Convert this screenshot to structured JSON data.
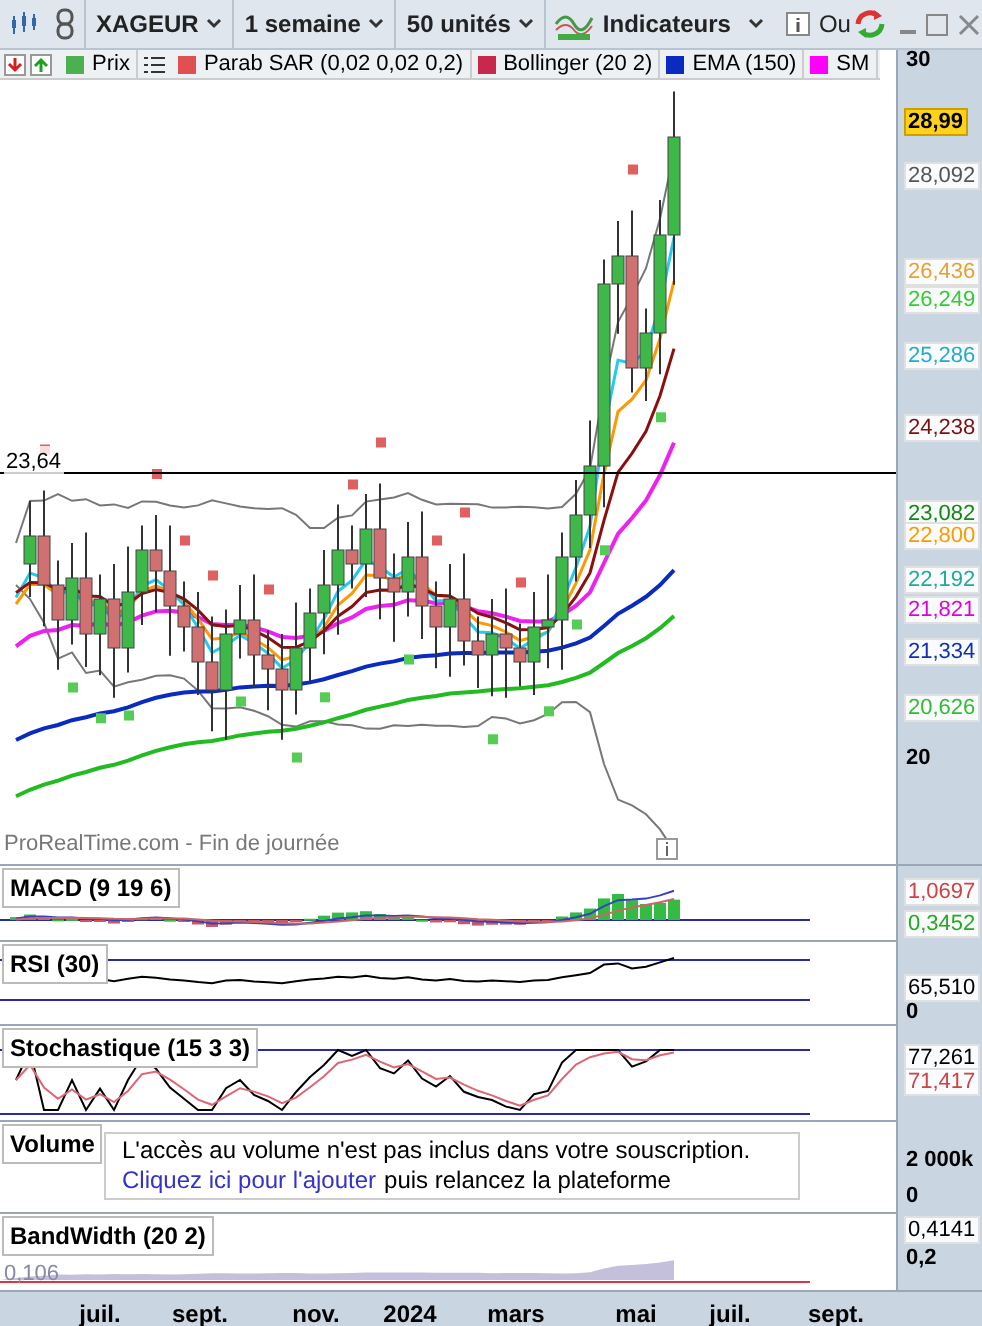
{
  "toolbar": {
    "symbol": "XAGEUR",
    "period": "1 semaine",
    "units": "50 unités",
    "indicators": "Indicateurs",
    "more": "Ou"
  },
  "legend": [
    {
      "label": "Prix",
      "color": "#4caf50"
    },
    {
      "label": "Parab SAR (0,02 0,02 0,2)",
      "color": "#e05050"
    },
    {
      "label": "Bollinger (20 2)",
      "color": "#c8284c"
    },
    {
      "label": "EMA (150)",
      "color": "#0a2bbf"
    },
    {
      "label": "SM",
      "color": "#ff00ff"
    }
  ],
  "main": {
    "watermark": "ProRealTime.com - Fin de journée",
    "level_label": "23,64",
    "axis": [
      {
        "text": "30",
        "kind": "tick"
      },
      {
        "text": "28,99",
        "kind": "current"
      },
      {
        "text": "28,092",
        "kind": "value",
        "color": "#555555"
      },
      {
        "text": "26,436",
        "kind": "value",
        "color": "#e8a030"
      },
      {
        "text": "26,249",
        "kind": "value",
        "color": "#33cc33"
      },
      {
        "text": "25,286",
        "kind": "value",
        "color": "#22aacc"
      },
      {
        "text": "24,238",
        "kind": "value",
        "color": "#7a1010"
      },
      {
        "text": "23,082",
        "kind": "value",
        "color": "#118811"
      },
      {
        "text": "22,800",
        "kind": "value",
        "color": "#ff9900"
      },
      {
        "text": "22,192",
        "kind": "value",
        "color": "#22aa99"
      },
      {
        "text": "21,821",
        "kind": "value",
        "color": "#dd00dd"
      },
      {
        "text": "21,334",
        "kind": "value",
        "color": "#1030b0"
      },
      {
        "text": "20,626",
        "kind": "value",
        "color": "#33bb33"
      },
      {
        "text": "20",
        "kind": "tick"
      }
    ]
  },
  "panels": [
    {
      "title": "MACD (9 19 6)",
      "kind": "macd",
      "axis": [
        {
          "text": "1,0697",
          "kind": "value",
          "color": "#cc4444"
        },
        {
          "text": "0,3452",
          "kind": "value",
          "color": "#22aa22"
        }
      ]
    },
    {
      "title": "RSI (30)",
      "kind": "rsi",
      "axis": [
        {
          "text": "65,510",
          "kind": "value",
          "color": "#000000"
        },
        {
          "text": "0",
          "kind": "tick"
        }
      ]
    },
    {
      "title": "Stochastique (15 3 3)",
      "kind": "stoch",
      "axis": [
        {
          "text": "77,261",
          "kind": "value",
          "color": "#000000"
        },
        {
          "text": "71,417",
          "kind": "value",
          "color": "#cc4444"
        }
      ]
    },
    {
      "title": "Volume",
      "kind": "volume",
      "axis": [
        {
          "text": "2 000k",
          "kind": "tick"
        },
        {
          "text": "0",
          "kind": "tick"
        }
      ],
      "notice": {
        "message": "L'accès au volume n'est pas inclus dans votre souscription.",
        "link": "Cliquez ici pour l'ajouter",
        "rest": "puis relancez la plateforme"
      }
    },
    {
      "title": "BandWidth (20 2)",
      "kind": "bandwidth",
      "low_label": "0,106",
      "axis": [
        {
          "text": "0,4141",
          "kind": "value",
          "color": "#000000"
        },
        {
          "text": "0,2",
          "kind": "tick"
        }
      ]
    }
  ],
  "x_axis": [
    "juil.",
    "sept.",
    "nov.",
    "2024",
    "mars",
    "mai",
    "juil.",
    "sept."
  ]
}
